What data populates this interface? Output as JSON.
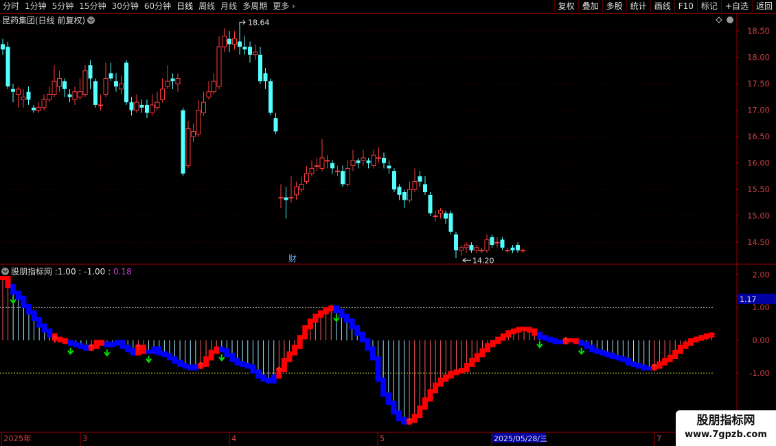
{
  "toolbar": {
    "periods": [
      "分时",
      "1分钟",
      "5分钟",
      "15分钟",
      "30分钟",
      "60分钟",
      "日线",
      "周线",
      "月线",
      "多周期",
      "更多"
    ],
    "active_period": "日线",
    "buttons": [
      "复权",
      "叠加",
      "多股",
      "统计",
      "画线",
      "F10",
      "标记",
      "+自选",
      "返回"
    ]
  },
  "price_panel": {
    "title": "昆药集团(日线 前复权)",
    "high_label": "18.64",
    "low_label": "14.20",
    "event_marker": "财"
  },
  "indicator_panel": {
    "title": "股朋指标网 :",
    "v1": "1.00",
    "v2": "-1.00",
    "v3": "0.18",
    "v3_color": "#d040d0",
    "current_tag": "1.17"
  },
  "x_axis": {
    "labels": [
      "2025年",
      "3",
      "4",
      "5",
      "2025/05/28/三",
      "7"
    ]
  },
  "watermark": {
    "line1": "股朋指标网",
    "line2": "www.7gpzb.com"
  },
  "colors": {
    "up": "#ff3c3c",
    "down": "#54ffff",
    "ind_up": "#ff0000",
    "ind_down": "#0000ff",
    "arrow_down": "#00e000",
    "arrow_up": "#ff2020",
    "axis": "#a00000"
  },
  "chart_data": [
    {
      "type": "candlestick",
      "title": "昆药集团(日线 前复权)",
      "y_ticks": [
        18.5,
        18.0,
        17.5,
        17.0,
        16.5,
        16.0,
        15.5,
        15.0,
        14.5
      ],
      "ylim": [
        14.1,
        18.8
      ],
      "grid": true,
      "candles": [
        [
          18.25,
          18.15,
          18.35,
          18.05
        ],
        [
          18.2,
          17.45,
          18.3,
          17.4
        ],
        [
          17.4,
          17.35,
          17.5,
          17.15
        ],
        [
          17.3,
          17.4,
          17.45,
          17.05
        ],
        [
          17.2,
          17.25,
          17.4,
          17.05
        ],
        [
          17.35,
          17.2,
          17.45,
          17.1
        ],
        [
          17.05,
          17.0,
          17.1,
          16.95
        ],
        [
          17.0,
          17.05,
          17.15,
          16.95
        ],
        [
          17.05,
          17.2,
          17.3,
          17.0
        ],
        [
          17.2,
          17.3,
          17.45,
          17.15
        ],
        [
          17.3,
          17.55,
          17.85,
          17.25
        ],
        [
          17.45,
          17.6,
          17.75,
          17.35
        ],
        [
          17.55,
          17.4,
          17.6,
          17.25
        ],
        [
          17.3,
          17.25,
          17.4,
          17.15
        ],
        [
          17.2,
          17.35,
          17.45,
          17.1
        ],
        [
          17.25,
          17.35,
          17.6,
          17.2
        ],
        [
          17.3,
          17.75,
          17.85,
          17.25
        ],
        [
          17.85,
          17.6,
          17.95,
          17.4
        ],
        [
          17.55,
          17.1,
          17.6,
          17.05
        ],
        [
          17.1,
          17.1,
          17.3,
          17.0
        ],
        [
          17.3,
          17.6,
          17.9,
          17.25
        ],
        [
          17.7,
          17.6,
          17.9,
          17.55
        ],
        [
          17.55,
          17.45,
          17.7,
          17.35
        ],
        [
          17.4,
          17.5,
          17.65,
          17.3
        ],
        [
          17.9,
          17.15,
          17.95,
          17.1
        ],
        [
          17.15,
          17.0,
          17.25,
          16.9
        ],
        [
          17.0,
          17.15,
          17.3,
          16.95
        ],
        [
          17.1,
          17.05,
          17.2,
          16.95
        ],
        [
          17.1,
          16.95,
          17.2,
          16.85
        ],
        [
          16.95,
          17.1,
          17.3,
          16.9
        ],
        [
          17.05,
          17.15,
          17.35,
          17.0
        ],
        [
          17.2,
          17.4,
          17.6,
          17.15
        ],
        [
          17.45,
          17.55,
          17.85,
          17.4
        ],
        [
          17.6,
          17.55,
          17.7,
          17.4
        ],
        [
          17.5,
          17.6,
          17.7,
          17.35
        ],
        [
          17.0,
          15.8,
          17.05,
          15.75
        ],
        [
          15.95,
          16.65,
          16.8,
          15.9
        ],
        [
          16.5,
          16.6,
          16.75,
          16.4
        ],
        [
          16.55,
          17.0,
          17.2,
          16.5
        ],
        [
          16.95,
          17.15,
          17.35,
          16.9
        ],
        [
          17.25,
          17.35,
          17.55,
          17.2
        ],
        [
          17.35,
          17.55,
          17.7,
          17.3
        ],
        [
          17.45,
          18.2,
          18.4,
          17.4
        ],
        [
          18.2,
          18.4,
          18.55,
          18.1
        ],
        [
          18.35,
          18.25,
          18.5,
          18.1
        ],
        [
          18.25,
          18.35,
          18.5,
          18.15
        ],
        [
          18.3,
          18.2,
          18.6,
          18.05
        ],
        [
          18.2,
          18.15,
          18.4,
          18.05
        ],
        [
          18.2,
          18.05,
          18.3,
          17.9
        ],
        [
          18.05,
          18.1,
          18.25,
          17.95
        ],
        [
          18.05,
          17.55,
          18.2,
          17.5
        ],
        [
          17.7,
          17.55,
          17.8,
          17.4
        ],
        [
          17.55,
          16.95,
          17.6,
          16.9
        ],
        [
          16.85,
          16.6,
          16.95,
          16.55
        ],
        [
          15.35,
          15.35,
          15.6,
          15.15
        ],
        [
          15.35,
          15.3,
          15.55,
          14.95
        ],
        [
          15.35,
          15.35,
          15.75,
          15.25
        ],
        [
          15.4,
          15.55,
          15.65,
          15.3
        ],
        [
          15.5,
          15.6,
          15.75,
          15.45
        ],
        [
          15.65,
          15.8,
          15.95,
          15.6
        ],
        [
          15.8,
          15.9,
          16.05,
          15.75
        ],
        [
          15.95,
          15.95,
          16.1,
          15.85
        ],
        [
          15.9,
          16.1,
          16.45,
          15.85
        ],
        [
          16.05,
          16.05,
          16.15,
          15.9
        ],
        [
          16.0,
          15.9,
          16.05,
          15.8
        ],
        [
          15.85,
          15.85,
          15.95,
          15.75
        ],
        [
          15.85,
          15.6,
          15.95,
          15.55
        ],
        [
          15.6,
          15.9,
          16.05,
          15.55
        ],
        [
          15.95,
          16.05,
          16.25,
          15.85
        ],
        [
          16.05,
          16.0,
          16.1,
          15.9
        ],
        [
          16.05,
          16.1,
          16.25,
          15.95
        ],
        [
          16.05,
          16.0,
          16.1,
          15.9
        ],
        [
          15.95,
          16.15,
          16.25,
          15.9
        ],
        [
          16.1,
          16.1,
          16.3,
          16.0
        ],
        [
          16.1,
          16.0,
          16.2,
          15.9
        ],
        [
          15.95,
          15.9,
          16.05,
          15.8
        ],
        [
          15.85,
          15.5,
          15.9,
          15.45
        ],
        [
          15.55,
          15.4,
          15.6,
          15.3
        ],
        [
          15.45,
          15.3,
          15.5,
          15.15
        ],
        [
          15.3,
          15.5,
          15.65,
          15.25
        ],
        [
          15.5,
          15.65,
          15.9,
          15.45
        ],
        [
          15.75,
          15.65,
          15.85,
          15.55
        ],
        [
          15.6,
          15.45,
          15.75,
          15.4
        ],
        [
          15.4,
          15.05,
          15.45,
          15.0
        ],
        [
          15.0,
          15.0,
          15.1,
          14.9
        ],
        [
          15.05,
          15.1,
          15.15,
          14.95
        ],
        [
          15.05,
          14.95,
          15.1,
          14.85
        ],
        [
          15.05,
          14.7,
          15.1,
          14.65
        ],
        [
          14.65,
          14.35,
          14.7,
          14.2
        ],
        [
          14.35,
          14.4,
          14.45,
          14.25
        ],
        [
          14.4,
          14.45,
          14.5,
          14.3
        ],
        [
          14.45,
          14.35,
          14.5,
          14.3
        ],
        [
          14.35,
          14.4,
          14.45,
          14.3
        ],
        [
          14.35,
          14.35,
          14.4,
          14.3
        ],
        [
          14.35,
          14.55,
          14.65,
          14.3
        ],
        [
          14.6,
          14.45,
          14.65,
          14.4
        ],
        [
          14.5,
          14.5,
          14.6,
          14.4
        ],
        [
          14.55,
          14.4,
          14.6,
          14.35
        ],
        [
          14.35,
          14.35,
          14.4,
          14.3
        ],
        [
          14.4,
          14.35,
          14.45,
          14.3
        ],
        [
          14.45,
          14.35,
          14.5,
          14.3
        ],
        [
          14.35,
          14.35,
          14.4,
          14.3
        ]
      ]
    },
    {
      "type": "bar",
      "title": "股朋指标网",
      "y_ticks": [
        2.0,
        1.0,
        0.0,
        -1.0
      ],
      "ylim": [
        -2.8,
        2.3
      ],
      "ref_lines": [
        1.0,
        -1.0
      ],
      "series": [
        {
          "values": [
            1.9,
            1.65,
            1.45,
            1.3,
            1.05,
            0.85,
            0.65,
            0.45,
            0.3,
            0.15,
            0.05,
            0.0,
            -0.05,
            -0.1,
            -0.15,
            -0.2,
            -0.25,
            -0.2,
            -0.05,
            -0.1,
            -0.15,
            -0.1,
            -0.05,
            -0.2,
            -0.3,
            -0.4,
            -0.2,
            -0.35,
            -0.35,
            -0.25,
            -0.4,
            -0.45,
            -0.55,
            -0.65,
            -0.75,
            -0.8,
            -0.85,
            -0.8,
            -0.75,
            -0.55,
            -0.35,
            -0.25,
            -0.3,
            -0.45,
            -0.6,
            -0.7,
            -0.75,
            -0.8,
            -0.95,
            -1.1,
            -1.2,
            -1.25,
            -1.1,
            -0.9,
            -0.6,
            -0.4,
            -0.2,
            0.1,
            0.4,
            0.6,
            0.75,
            0.85,
            0.95,
            1.0,
            0.9,
            0.75,
            0.6,
            0.4,
            0.2,
            0.0,
            -0.25,
            -0.55,
            -1.2,
            -1.65,
            -1.9,
            -2.2,
            -2.4,
            -2.5,
            -2.45,
            -2.3,
            -2.05,
            -1.8,
            -1.55,
            -1.35,
            -1.2,
            -1.1,
            -1.0,
            -0.95,
            -0.9,
            -0.75,
            -0.6,
            -0.45,
            -0.3,
            -0.15,
            -0.05,
            0.05,
            0.15,
            0.25,
            0.3,
            0.35,
            0.35,
            0.3,
            0.2,
            0.1,
            0.05,
            0.0,
            -0.05,
            -0.05,
            0.0,
            0.0,
            -0.05,
            -0.1,
            -0.2,
            -0.3,
            -0.35,
            -0.4,
            -0.45,
            -0.5,
            -0.55,
            -0.6,
            -0.7,
            -0.75,
            -0.8,
            -0.85,
            -0.85,
            -0.8,
            -0.7,
            -0.6,
            -0.5,
            -0.35,
            -0.2,
            -0.1,
            0.0,
            0.05,
            0.1,
            0.15,
            0.18
          ]
        },
        {
          "values": [
            1,
            1,
            0,
            0,
            0,
            0,
            0,
            0,
            0,
            0,
            1,
            1,
            1,
            0,
            0,
            0,
            0,
            1,
            1,
            1,
            0,
            0,
            0,
            0,
            0,
            0,
            1,
            1,
            0,
            0,
            0,
            0,
            0,
            0,
            0,
            0,
            0,
            0,
            1,
            1,
            1,
            1,
            0,
            0,
            0,
            0,
            0,
            0,
            0,
            0,
            0,
            0,
            0,
            1,
            1,
            1,
            1,
            1,
            1,
            1,
            1,
            1,
            1,
            1,
            0,
            0,
            0,
            0,
            0,
            0,
            0,
            0,
            0,
            0,
            0,
            0,
            0,
            0,
            1,
            1,
            1,
            1,
            1,
            1,
            1,
            1,
            1,
            1,
            1,
            1,
            1,
            1,
            1,
            1,
            1,
            1,
            1,
            1,
            1,
            1,
            1,
            1,
            1,
            0,
            0,
            0,
            0,
            0,
            1,
            1,
            1,
            0,
            0,
            0,
            0,
            0,
            0,
            0,
            0,
            0,
            0,
            0,
            0,
            0,
            0,
            1,
            1,
            1,
            1,
            1,
            1,
            1,
            1,
            1,
            1,
            1,
            1
          ]
        }
      ]
    }
  ]
}
